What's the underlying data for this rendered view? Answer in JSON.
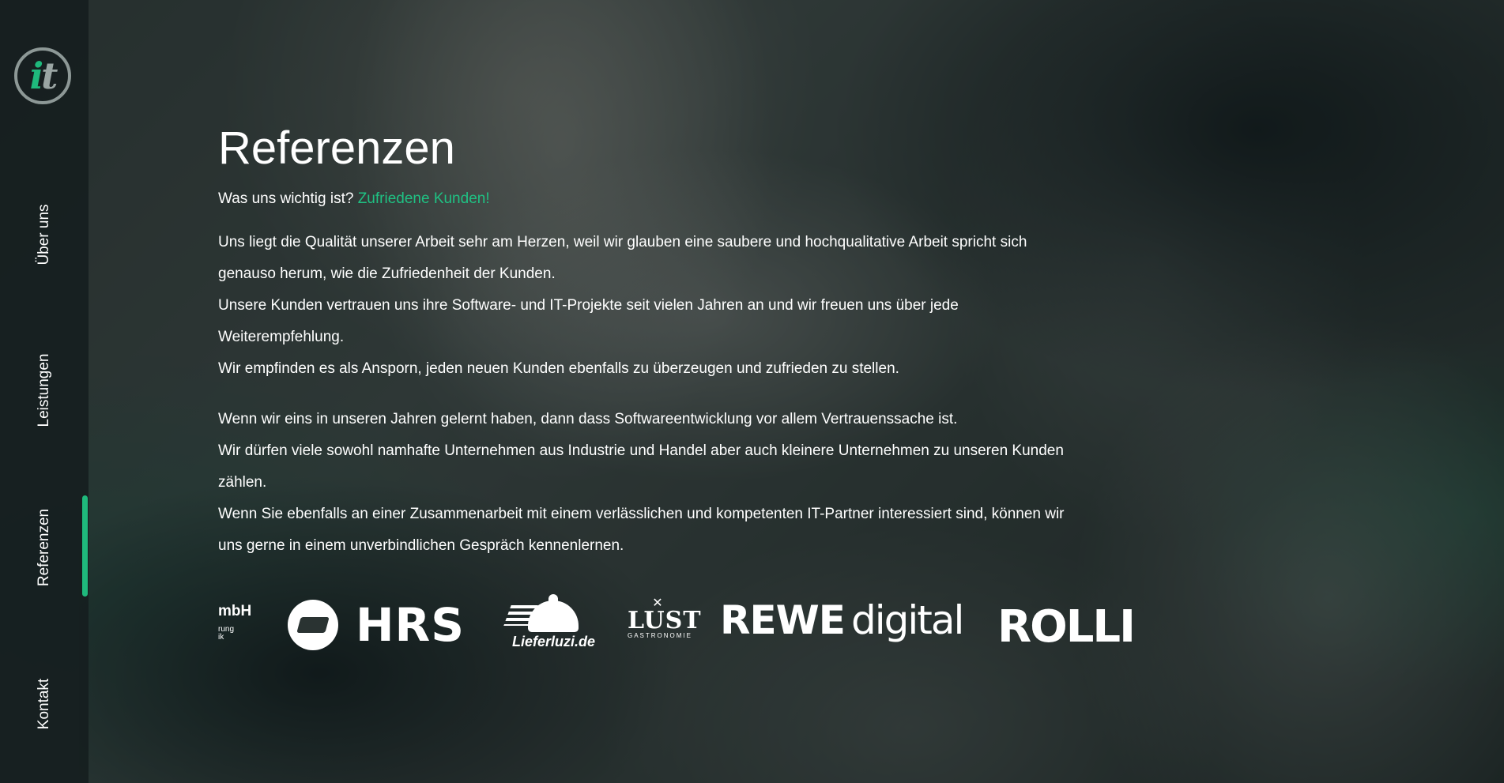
{
  "sidebar": {
    "logo": {
      "text_i": "i",
      "text_t": "t",
      "accent_color": "#1fb97c"
    },
    "nav": [
      {
        "label": "Über uns"
      },
      {
        "label": "Leistungen"
      },
      {
        "label": "Referenzen",
        "active": true
      },
      {
        "label": "Kontakt"
      }
    ]
  },
  "main": {
    "title": "Referenzen",
    "subtitle_prefix": "Was uns wichtig ist?",
    "subtitle_accent": "Zufriedene Kunden!",
    "paragraph1": [
      "Uns liegt die Qualität unserer Arbeit sehr am Herzen, weil wir glauben eine saubere und hochqualitative Arbeit spricht sich",
      "genauso herum, wie die Zufriedenheit der Kunden.",
      "Unsere Kunden vertrauen uns ihre Software- und IT-Projekte seit vielen Jahren an und wir freuen uns über jede",
      "Weiterempfehlung.",
      "Wir empfinden es als Ansporn, jeden neuen Kunden ebenfalls zu überzeugen und zufrieden zu stellen."
    ],
    "paragraph2": [
      "Wenn wir eins in unseren Jahren gelernt haben, dann dass Softwareentwicklung vor allem Vertrauenssache ist.",
      "Wir dürfen viele sowohl namhafte Unternehmen aus Industrie und Handel aber auch kleinere Unternehmen zu unseren Kunden",
      "zählen.",
      "Wenn Sie ebenfalls an einer Zusammenarbeit mit einem verlässlichen und kompetenten IT-Partner interessiert sind, können wir",
      "uns gerne in einem unverbindlichen Gespräch kennenlernen."
    ]
  },
  "logos": {
    "mbh": {
      "main": "mbH",
      "line1": "rung",
      "line2": "ik"
    },
    "hrs": "HRS",
    "lieferluzi": "Lieferluzi.de",
    "lust": {
      "icon": "crossed-forks",
      "word": "LUST",
      "sub": "GASTRONOMIE"
    },
    "rewe": {
      "bold": "REWE",
      "light": "digital"
    },
    "rolli": "ROLLI"
  },
  "colors": {
    "accent": "#1fb97c",
    "text": "#ffffff",
    "sidebar_bg": "#161e1f"
  }
}
